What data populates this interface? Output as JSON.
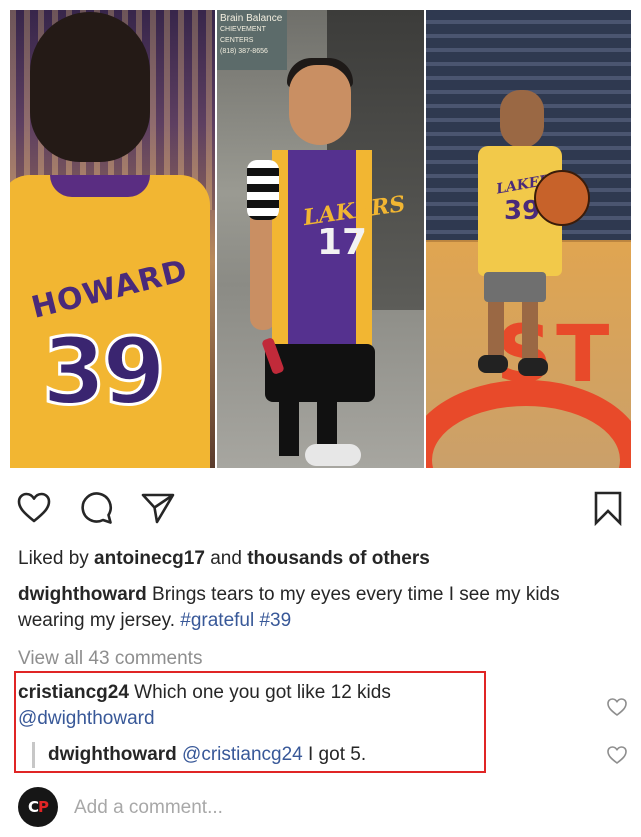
{
  "post": {
    "image": {
      "panel_left": {
        "jersey_name": "HOWARD",
        "jersey_number": "39"
      },
      "panel_middle": {
        "sign_text_line1": "Brain Balance",
        "sign_text_line2": "CHIEVEMENT CENTERS",
        "sign_text_line3": "(818) 387-8656",
        "jersey_label": "LAKERS",
        "jersey_number": "17"
      },
      "panel_right": {
        "jersey_label": "LAKERS",
        "jersey_number": "39",
        "court_text": "ST"
      }
    },
    "actions": {
      "like_icon": "heart-outline-icon",
      "comment_icon": "speech-bubble-icon",
      "share_icon": "paper-plane-icon",
      "save_icon": "bookmark-icon"
    },
    "likes": {
      "prefix": "Liked by ",
      "user": "antoinecg17",
      "middle": " and ",
      "rest": "thousands of others"
    },
    "caption": {
      "user": "dwighthoward",
      "text": " Brings tears to my eyes every time I see my kids wearing my jersey. ",
      "hashtags": "#grateful #39"
    },
    "view_all": "View all 43 comments",
    "comments": [
      {
        "user": "cristiancg24",
        "text": " Which one you got like 12 kids ",
        "mention": "@dwighthoward"
      },
      {
        "user": "dwighthoward",
        "mention": "@cristiancg24",
        "text": " I got 5."
      }
    ],
    "add_comment": {
      "placeholder": "Add a comment...",
      "avatar_text_1": "C",
      "avatar_text_2": "P"
    },
    "colors": {
      "highlight_border": "#e02525",
      "link": "#385898",
      "muted": "#8e8e8e"
    }
  }
}
